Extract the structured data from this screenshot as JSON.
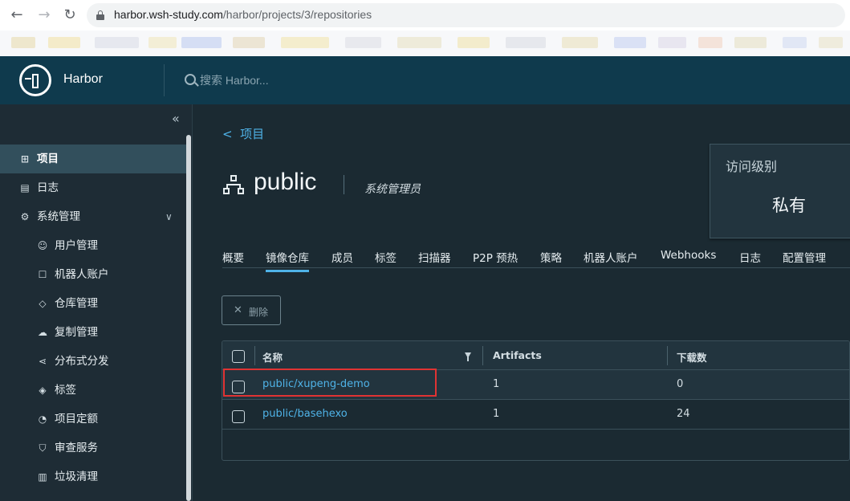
{
  "browser": {
    "url_host": "harbor.wsh-study.com",
    "url_path": "/harbor/projects/3/repositories"
  },
  "header": {
    "brand": "Harbor",
    "search_placeholder": "搜索 Harbor..."
  },
  "sidebar": {
    "items": [
      {
        "label": "项目",
        "icon": "project-icon"
      },
      {
        "label": "日志",
        "icon": "log-icon"
      },
      {
        "label": "系统管理",
        "icon": "admin-icon"
      },
      {
        "label": "用户管理",
        "icon": "users-icon"
      },
      {
        "label": "机器人账户",
        "icon": "robot-icon"
      },
      {
        "label": "仓库管理",
        "icon": "registry-icon"
      },
      {
        "label": "复制管理",
        "icon": "cloud-icon"
      },
      {
        "label": "分布式分发",
        "icon": "share-icon"
      },
      {
        "label": "标签",
        "icon": "tag-icon"
      },
      {
        "label": "项目定额",
        "icon": "quota-icon"
      },
      {
        "label": "审查服务",
        "icon": "shield-icon"
      },
      {
        "label": "垃圾清理",
        "icon": "trash-icon"
      }
    ]
  },
  "main": {
    "back_label": "项目",
    "project_name": "public",
    "role": "系统管理员",
    "access": {
      "label": "访问级别",
      "value": "私有"
    },
    "tabs": [
      "概要",
      "镜像仓库",
      "成员",
      "标签",
      "扫描器",
      "P2P 预热",
      "策略",
      "机器人账户",
      "Webhooks",
      "日志",
      "配置管理"
    ],
    "delete_label": "删除",
    "table": {
      "columns": [
        "名称",
        "Artifacts",
        "下载数"
      ],
      "rows": [
        {
          "name": "public/xupeng-demo",
          "artifacts": "1",
          "downloads": "0"
        },
        {
          "name": "public/basehexo",
          "artifacts": "1",
          "downloads": "24"
        }
      ]
    }
  },
  "colors": {
    "header_bg": "#0f3a4d",
    "accent": "#4fb3e8",
    "highlight": "#e03333"
  }
}
